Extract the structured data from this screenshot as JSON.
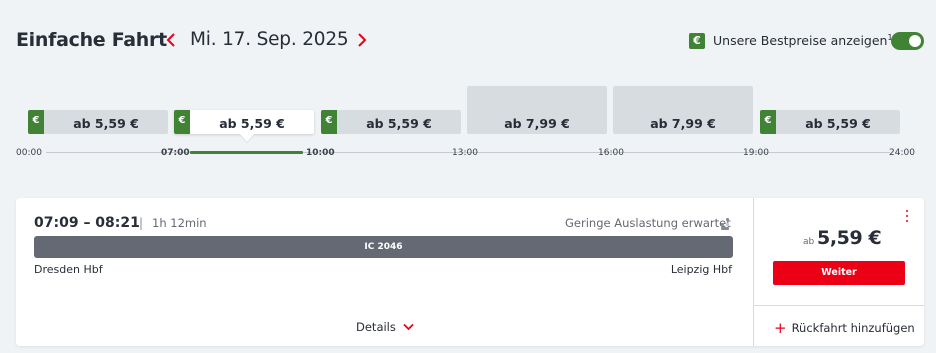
{
  "header": {
    "title": "Einfache Fahrt",
    "date": "Mi. 17. Sep. 2025",
    "prev_icon": "chevron-left-icon",
    "next_icon": "chevron-right-icon",
    "best_price_badge": "€",
    "best_price_label": "Unsere Bestpreise anzeigen",
    "best_price_footnote": "1",
    "best_price_toggle_on": true
  },
  "timeline": {
    "slots": [
      {
        "label": "ab 5,59 €",
        "best": true,
        "selected": false
      },
      {
        "label": "ab 5,59 €",
        "best": true,
        "selected": true
      },
      {
        "label": "ab 5,59 €",
        "best": true,
        "selected": false
      },
      {
        "label": "ab 7,99 €",
        "best": false,
        "selected": false
      },
      {
        "label": "ab 7,99 €",
        "best": false,
        "selected": false
      },
      {
        "label": "ab 5,59 €",
        "best": true,
        "selected": false
      }
    ],
    "ticks": [
      "00:00",
      "07:00",
      "10:00",
      "13:00",
      "16:00",
      "19:00",
      "24:00"
    ],
    "euro_badge": "€"
  },
  "connection": {
    "times": "07:09 – 08:21",
    "separator": "|",
    "duration": "1h 12min",
    "occupancy": "Geringe Auslastung erwartet",
    "train": "IC 2046",
    "from": "Dresden Hbf",
    "to": "Leipzig Hbf",
    "details_label": "Details",
    "price_prefix": "ab",
    "price": "5,59 €",
    "continue_label": "Weiter",
    "return_label": "Rückfahrt hinzufügen",
    "return_icon": "+"
  },
  "colors": {
    "accent_red": "#ec0016",
    "best_price_green": "#408335",
    "background": "#f0f3f5"
  }
}
